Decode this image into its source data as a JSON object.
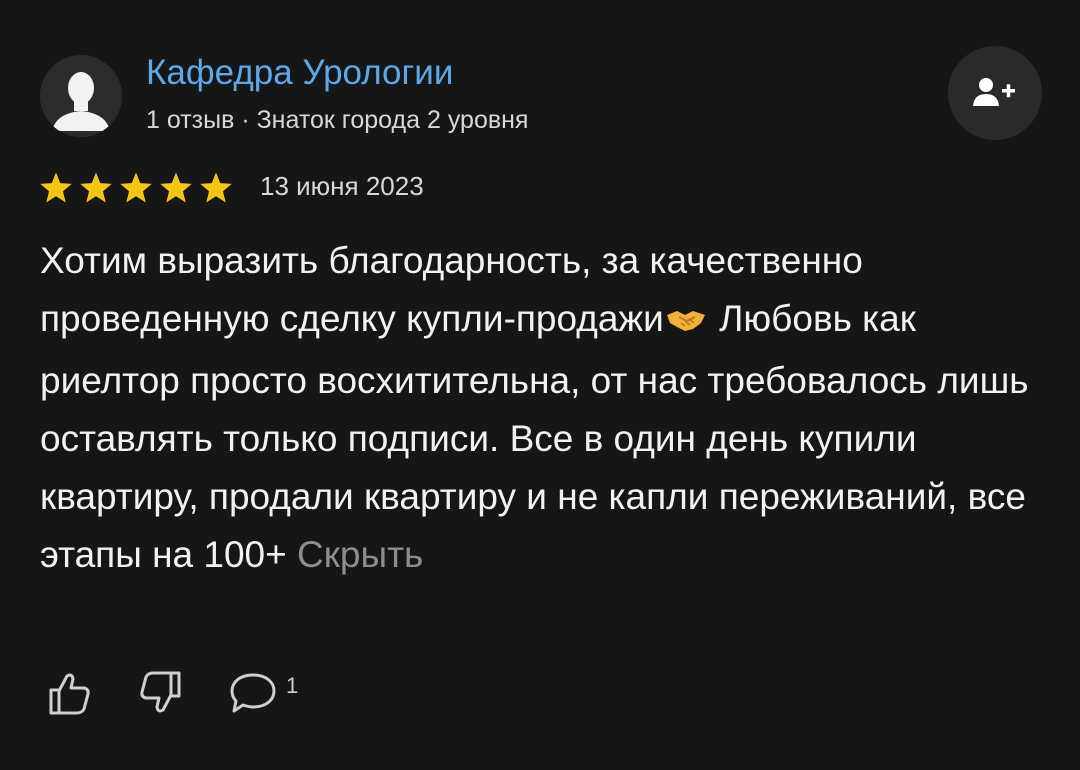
{
  "author": {
    "name": "Кафедра Урологии",
    "meta": "1 отзыв · Знаток города 2 уровня",
    "avatar_icon": "user-silhouette-icon"
  },
  "subscribe": {
    "icon": "add-user-icon"
  },
  "review": {
    "rating": 5,
    "max_rating": 5,
    "star_color": "#f5c518",
    "date": "13 июня 2023",
    "text_before_emoji": "Хотим выразить благодарность, за качественно проведенную сделку купли-продажи",
    "emoji_icon": "handshake-icon",
    "text_after_emoji": " Любовь как риелтор просто восхитительна, от нас требовалось лишь оставлять только подписи. Все в один день купили квартиру, продали квартиру и не капли переживаний, все этапы на 100+ ",
    "hide_label": "Скрыть"
  },
  "actions": {
    "like_icon": "thumbs-up-icon",
    "dislike_icon": "thumbs-down-icon",
    "comment_icon": "comment-icon",
    "comment_count": "1"
  },
  "colors": {
    "background": "#161616",
    "link": "#5da8e9",
    "muted": "#8d8d8d"
  }
}
